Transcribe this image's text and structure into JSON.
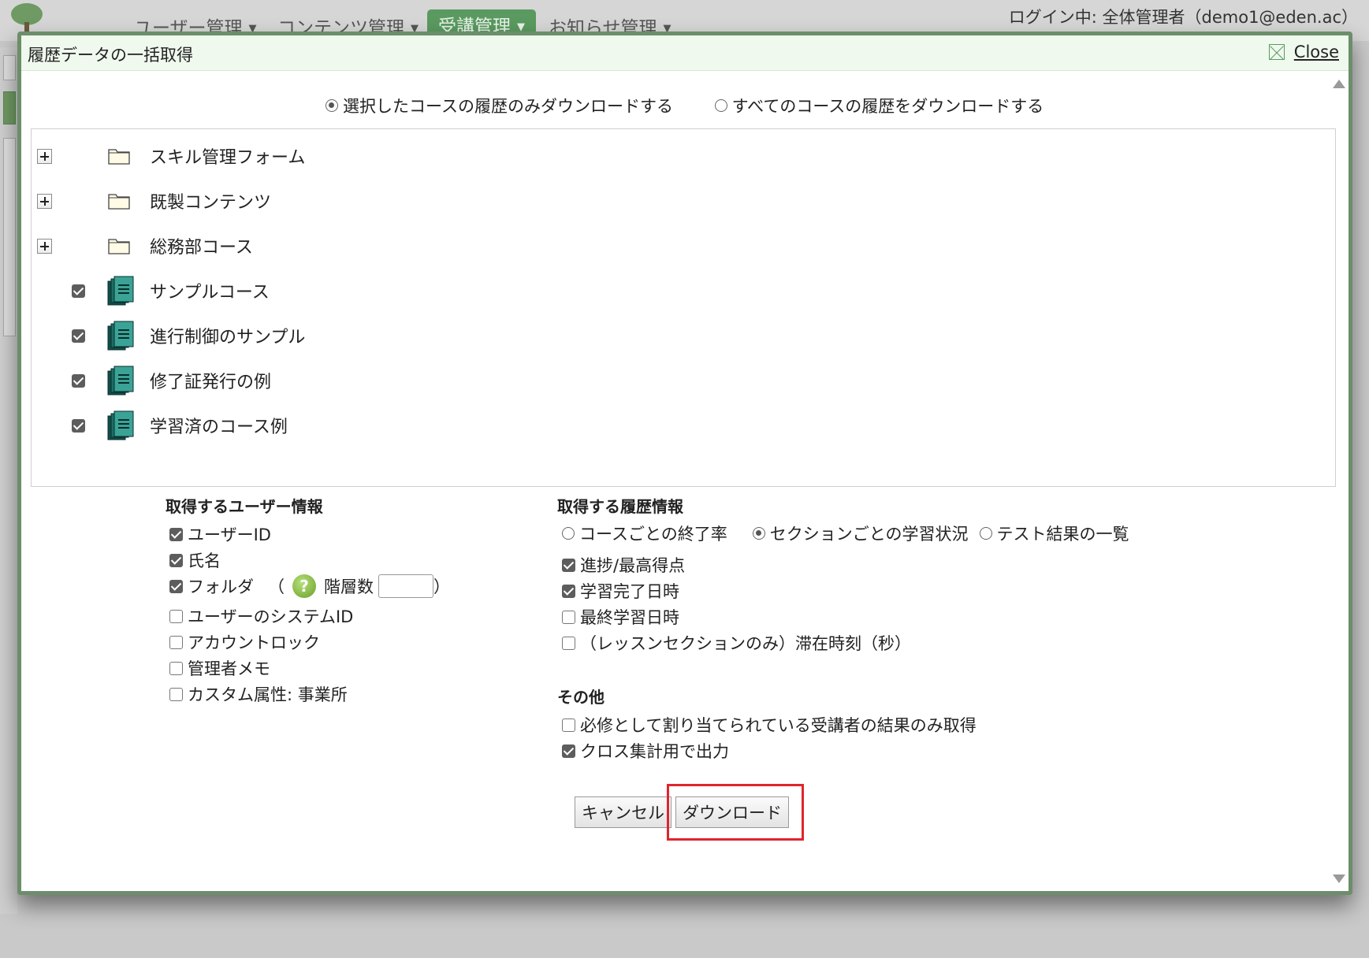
{
  "topnav": {
    "items": [
      {
        "label": "ユーザー管理"
      },
      {
        "label": "コンテンツ管理"
      },
      {
        "label": "受講管理"
      },
      {
        "label": "お知らせ管理"
      }
    ],
    "login_info": "ログイン中: 全体管理者（demo1@eden.ac）"
  },
  "dialog": {
    "title": "履歴データの一括取得",
    "close_label": "Close",
    "scope": {
      "selected_only": "選択したコースの履歴のみダウンロードする",
      "all": "すべてのコースの履歴をダウンロードする",
      "selected": "selected_only"
    },
    "tree": [
      {
        "type": "folder",
        "label": "スキル管理フォーム"
      },
      {
        "type": "folder",
        "label": "既製コンテンツ"
      },
      {
        "type": "folder",
        "label": "総務部コース"
      },
      {
        "type": "course",
        "label": "サンプルコース",
        "checked": true
      },
      {
        "type": "course",
        "label": "進行制御のサンプル",
        "checked": true
      },
      {
        "type": "course",
        "label": "修了証発行の例",
        "checked": true
      },
      {
        "type": "course",
        "label": "学習済のコース例",
        "checked": true
      }
    ],
    "user_info": {
      "title": "取得するユーザー情報",
      "user_id": "ユーザーID",
      "name": "氏名",
      "folder": "フォルダ",
      "folder_open_paren": "（",
      "level_label": "階層数",
      "folder_close_paren": "）",
      "system_id": "ユーザーのシステムID",
      "account_lock": "アカウントロック",
      "admin_memo": "管理者メモ",
      "custom_attr": "カスタム属性: 事業所"
    },
    "history_info": {
      "title": "取得する履歴情報",
      "mode_completion": "コースごとの終了率",
      "mode_section": "セクションごとの学習状況",
      "mode_test": "テスト結果の一覧",
      "progress": "進捗/最高得点",
      "completed_at": "学習完了日時",
      "last_learned": "最終学習日時",
      "stay_time": "（レッスンセクションのみ）滞在時刻（秒）"
    },
    "other": {
      "title": "その他",
      "required_only": "必修として割り当てられている受講者の結果のみ取得",
      "cross_tab": "クロス集計用で出力"
    },
    "buttons": {
      "cancel": "キャンセル",
      "download": "ダウンロード"
    }
  }
}
